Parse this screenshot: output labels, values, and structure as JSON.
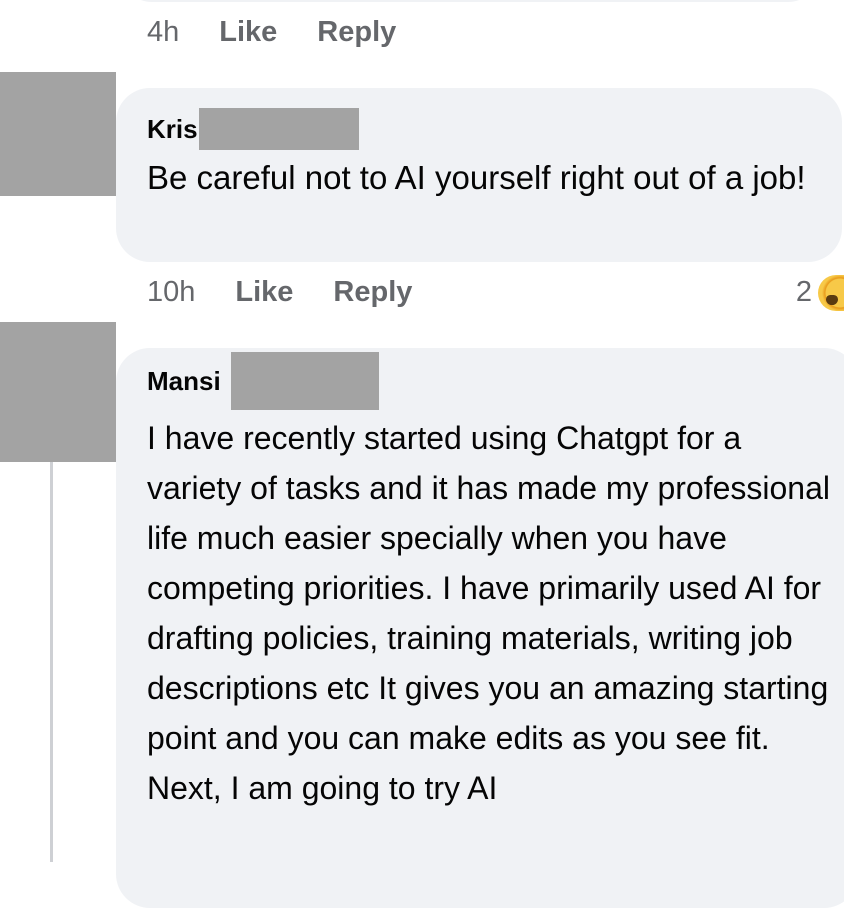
{
  "comments": [
    {
      "time": "4h",
      "like_label": "Like",
      "reply_label": "Reply"
    },
    {
      "author": "Kris",
      "text": "Be careful not to AI yourself right out of a job!",
      "time": "10h",
      "like_label": "Like",
      "reply_label": "Reply",
      "reaction_count": "2"
    },
    {
      "author": "Mansi",
      "text": "I have recently started using Chatgpt for a variety of tasks and it has made my professional life much easier specially when you have competing priorities. I have primarily used AI for drafting policies, training materials, writing job descriptions etc It gives you an amazing starting point and you can make edits as you see fit. Next, I am going to try AI"
    }
  ],
  "colors": {
    "bubble": "#f0f2f5",
    "secondary_text": "#65676b",
    "redaction": "#a3a3a3"
  },
  "icons": {
    "reaction": "surprised-emoji-icon"
  }
}
